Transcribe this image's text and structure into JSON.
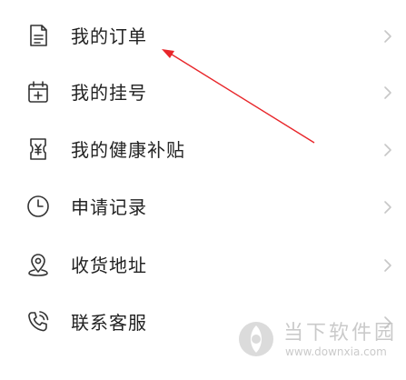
{
  "menu": {
    "items": [
      {
        "label": "我的订单",
        "icon": "order-document-icon"
      },
      {
        "label": "我的挂号",
        "icon": "calendar-plus-icon"
      },
      {
        "label": "我的健康补贴",
        "icon": "yuan-voucher-icon"
      },
      {
        "label": "申请记录",
        "icon": "clock-icon"
      },
      {
        "label": "收货地址",
        "icon": "location-pin-icon"
      },
      {
        "label": "联系客服",
        "icon": "phone-call-icon"
      }
    ]
  },
  "colors": {
    "icon_stroke": "#333333",
    "chevron": "#c7c7c7",
    "annotation_arrow": "#e8262a",
    "label_text": "#222222"
  },
  "watermark": {
    "title": "当下软件园",
    "url": "www.downxia.com"
  }
}
